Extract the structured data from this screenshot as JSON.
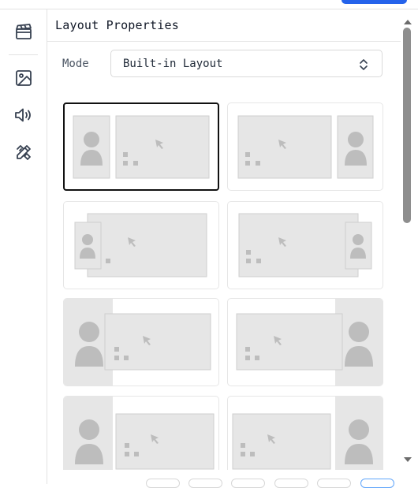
{
  "panel": {
    "title": "Layout Properties",
    "mode_label": "Mode",
    "mode_value": "Built-in Layout"
  },
  "rail": {
    "items": [
      "clapperboard-icon",
      "image-icon",
      "speaker-icon",
      "design-tools-icon"
    ]
  },
  "layouts": [
    {
      "name": "camera-left-screen-right",
      "selected": true
    },
    {
      "name": "screen-left-camera-right",
      "selected": false
    },
    {
      "name": "camera-overlay-bottom-left",
      "selected": false
    },
    {
      "name": "camera-overlay-bottom-right",
      "selected": false
    },
    {
      "name": "camera-tall-left",
      "selected": false
    },
    {
      "name": "camera-tall-right",
      "selected": false
    },
    {
      "name": "camera-tall-left-2",
      "selected": false
    },
    {
      "name": "camera-tall-right-2",
      "selected": false
    }
  ],
  "colors": {
    "accent": "#2563eb",
    "selected_border": "#111111",
    "placeholder": "#e6e6e6",
    "glyph": "#bdbdbd"
  }
}
